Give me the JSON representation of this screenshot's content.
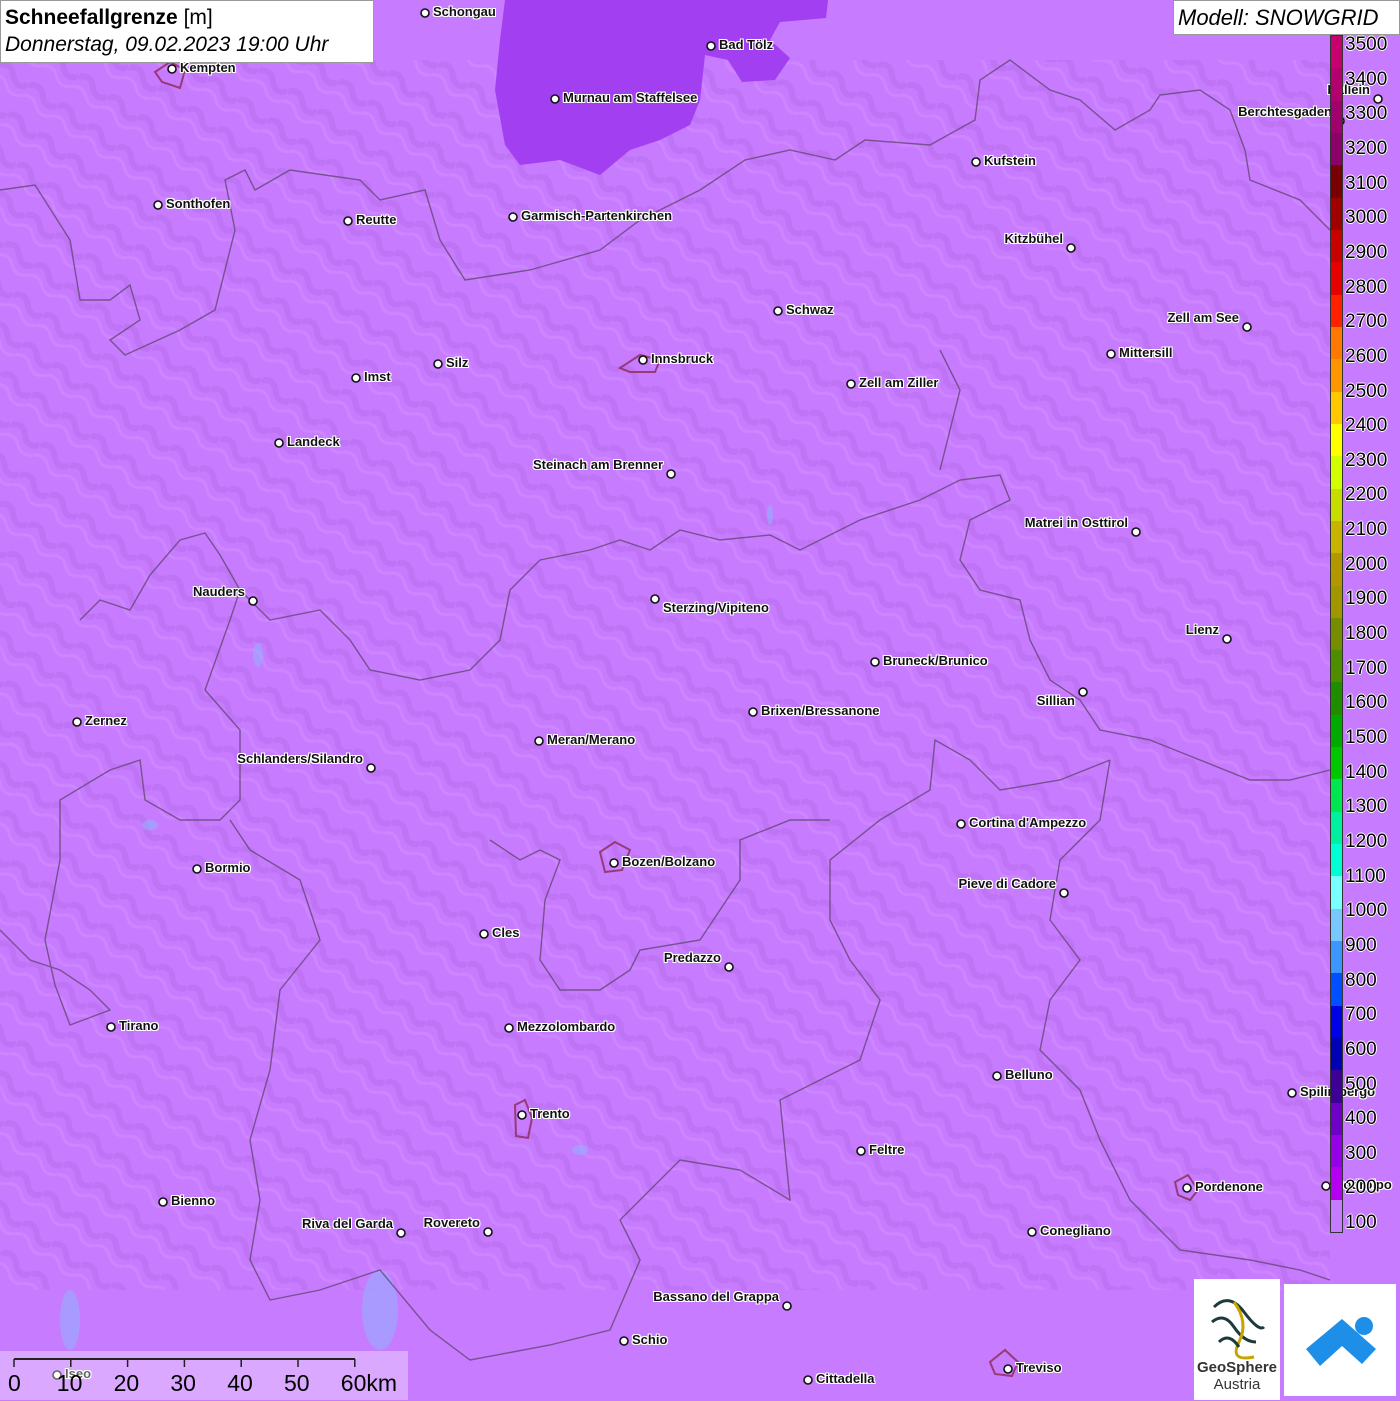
{
  "title": {
    "variable": "Schneefallgrenze",
    "unit": "[m]",
    "datetime": "Donnerstag, 09.02.2023 19:00 Uhr"
  },
  "model": "Modell: SNOWGRID",
  "cities": [
    {
      "name": "Schongau"
    },
    {
      "name": "Bad Tölz"
    },
    {
      "name": "Kempten"
    },
    {
      "name": "Murnau am Staffelsee"
    },
    {
      "name": "Hallein"
    },
    {
      "name": "Berchtesgaden"
    },
    {
      "name": "Kufstein"
    },
    {
      "name": "Sonthofen"
    },
    {
      "name": "Reutte"
    },
    {
      "name": "Garmisch-Partenkirchen"
    },
    {
      "name": "Kitzbühel"
    },
    {
      "name": "Schwaz"
    },
    {
      "name": "Zell am See"
    },
    {
      "name": "Mittersill"
    },
    {
      "name": "Innsbruck"
    },
    {
      "name": "Imst"
    },
    {
      "name": "Silz"
    },
    {
      "name": "Zell am Ziller"
    },
    {
      "name": "Landeck"
    },
    {
      "name": "Steinach am Brenner"
    },
    {
      "name": "Matrei in Osttirol"
    },
    {
      "name": "Nauders"
    },
    {
      "name": "Sterzing/Vipiteno"
    },
    {
      "name": "Lienz"
    },
    {
      "name": "Bruneck/Brunico"
    },
    {
      "name": "Sillian"
    },
    {
      "name": "Brixen/Bressanone"
    },
    {
      "name": "Zernez"
    },
    {
      "name": "Meran/Merano"
    },
    {
      "name": "Schlanders/Silandro"
    },
    {
      "name": "Cortina d'Ampezzo"
    },
    {
      "name": "Bozen/Bolzano"
    },
    {
      "name": "Bormio"
    },
    {
      "name": "Pieve di Cadore"
    },
    {
      "name": "Cles"
    },
    {
      "name": "Predazzo"
    },
    {
      "name": "Tirano"
    },
    {
      "name": "Mezzolombardo"
    },
    {
      "name": "Belluno"
    },
    {
      "name": "Spilimbergo"
    },
    {
      "name": "Trento"
    },
    {
      "name": "Feltre"
    },
    {
      "name": "Pordenone"
    },
    {
      "name": "Codroipo"
    },
    {
      "name": "Bienno"
    },
    {
      "name": "Riva del Garda"
    },
    {
      "name": "Rovereto"
    },
    {
      "name": "Conegliano"
    },
    {
      "name": "Bassano del Grappa"
    },
    {
      "name": "Schio"
    },
    {
      "name": "Iseo"
    },
    {
      "name": "Treviso"
    },
    {
      "name": "Cittadella"
    }
  ],
  "legend": {
    "levels": [
      3500,
      3400,
      3300,
      3200,
      3100,
      3000,
      2900,
      2800,
      2700,
      2600,
      2500,
      2400,
      2300,
      2200,
      2100,
      2000,
      1900,
      1800,
      1700,
      1600,
      1500,
      1400,
      1300,
      1200,
      1100,
      1000,
      900,
      800,
      700,
      600,
      500,
      400,
      300,
      200,
      100
    ],
    "colors": [
      "#c8006e",
      "#b4006e",
      "#a0006e",
      "#8c006a",
      "#780000",
      "#a00000",
      "#c80000",
      "#e60000",
      "#ff2000",
      "#ff7800",
      "#ff9600",
      "#ffc800",
      "#ffff00",
      "#d2ff00",
      "#c8dc00",
      "#c8b400",
      "#b49600",
      "#a09600",
      "#788c00",
      "#508c00",
      "#208c00",
      "#00aa00",
      "#00c800",
      "#00e650",
      "#00f0a0",
      "#00ffd2",
      "#78ffff",
      "#78c8ff",
      "#3c96ff",
      "#0050ff",
      "#0000e6",
      "#0000b4",
      "#3c0096",
      "#6e00c8",
      "#9600e6",
      "#b400f0",
      "#c77bff"
    ]
  },
  "scale": {
    "ticks": [
      "0",
      "10",
      "20",
      "30",
      "40",
      "50",
      "60km"
    ]
  },
  "logo": {
    "name_line1": "GeoSphere",
    "name_line2": "Austria"
  },
  "map_colors": {
    "background": "#c77bff",
    "low_zone": "#a23ff0",
    "border": "#6a4a7a"
  }
}
